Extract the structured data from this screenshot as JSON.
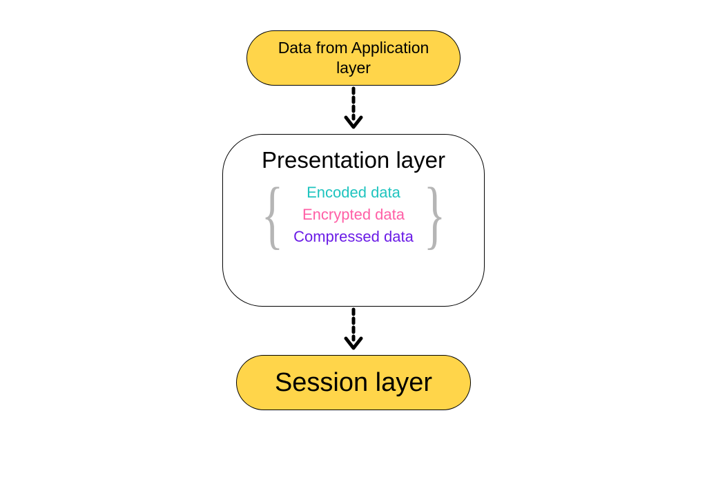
{
  "top_box": {
    "label": "Data from Application layer"
  },
  "presentation": {
    "title": "Presentation layer",
    "items": {
      "encoded": "Encoded data",
      "encrypted": "Encrypted data",
      "compressed": "Compressed data"
    }
  },
  "bottom_box": {
    "label": "Session layer"
  }
}
